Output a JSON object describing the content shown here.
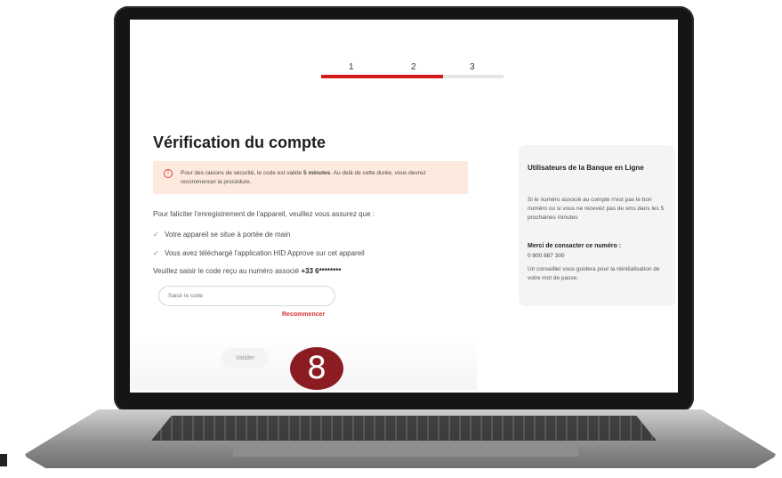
{
  "stepper": {
    "steps": [
      "1",
      "2",
      "3"
    ],
    "active_step": 2,
    "progress_fraction": 0.67,
    "active_color": "#d31a1a"
  },
  "verification": {
    "title": "Vérification du compte",
    "alert_prefix": "Pour des raisons de sécurité, le code est valide",
    "alert_strong": "5 minutes",
    "alert_suffix": ". Au delà de cette durée, vous devrez recommencer la procédure.",
    "alert_icon": "info-icon",
    "intro": "Pour faliciter l'enregistrement de l'appareil, veuillez vous assurez que :",
    "checks": [
      "Votre appareil se situe à portée de main",
      "Vous avez téléchargé l'application HID Approve sur cet appareil"
    ],
    "code_label": "Veuillez saisir le code reçu au numéro associé",
    "masked_number": "+33 6********",
    "code_placeholder": "Saisir le code",
    "restart": "Recommencer",
    "validate": "Valider"
  },
  "side": {
    "title": "Utilisateurs de la Banque en Ligne",
    "text": "Si le numéro associé au compte n'est pas le bon numéro ou si vous ne recevez pas de sms dans les 5 prochaines minutes",
    "merci": "Merci de consacter ce numéro :",
    "phone": "0 800 887 300",
    "help": "Un conseiller vous guidera pour la réinitialisation de votre mot de passe."
  },
  "badge": "8"
}
